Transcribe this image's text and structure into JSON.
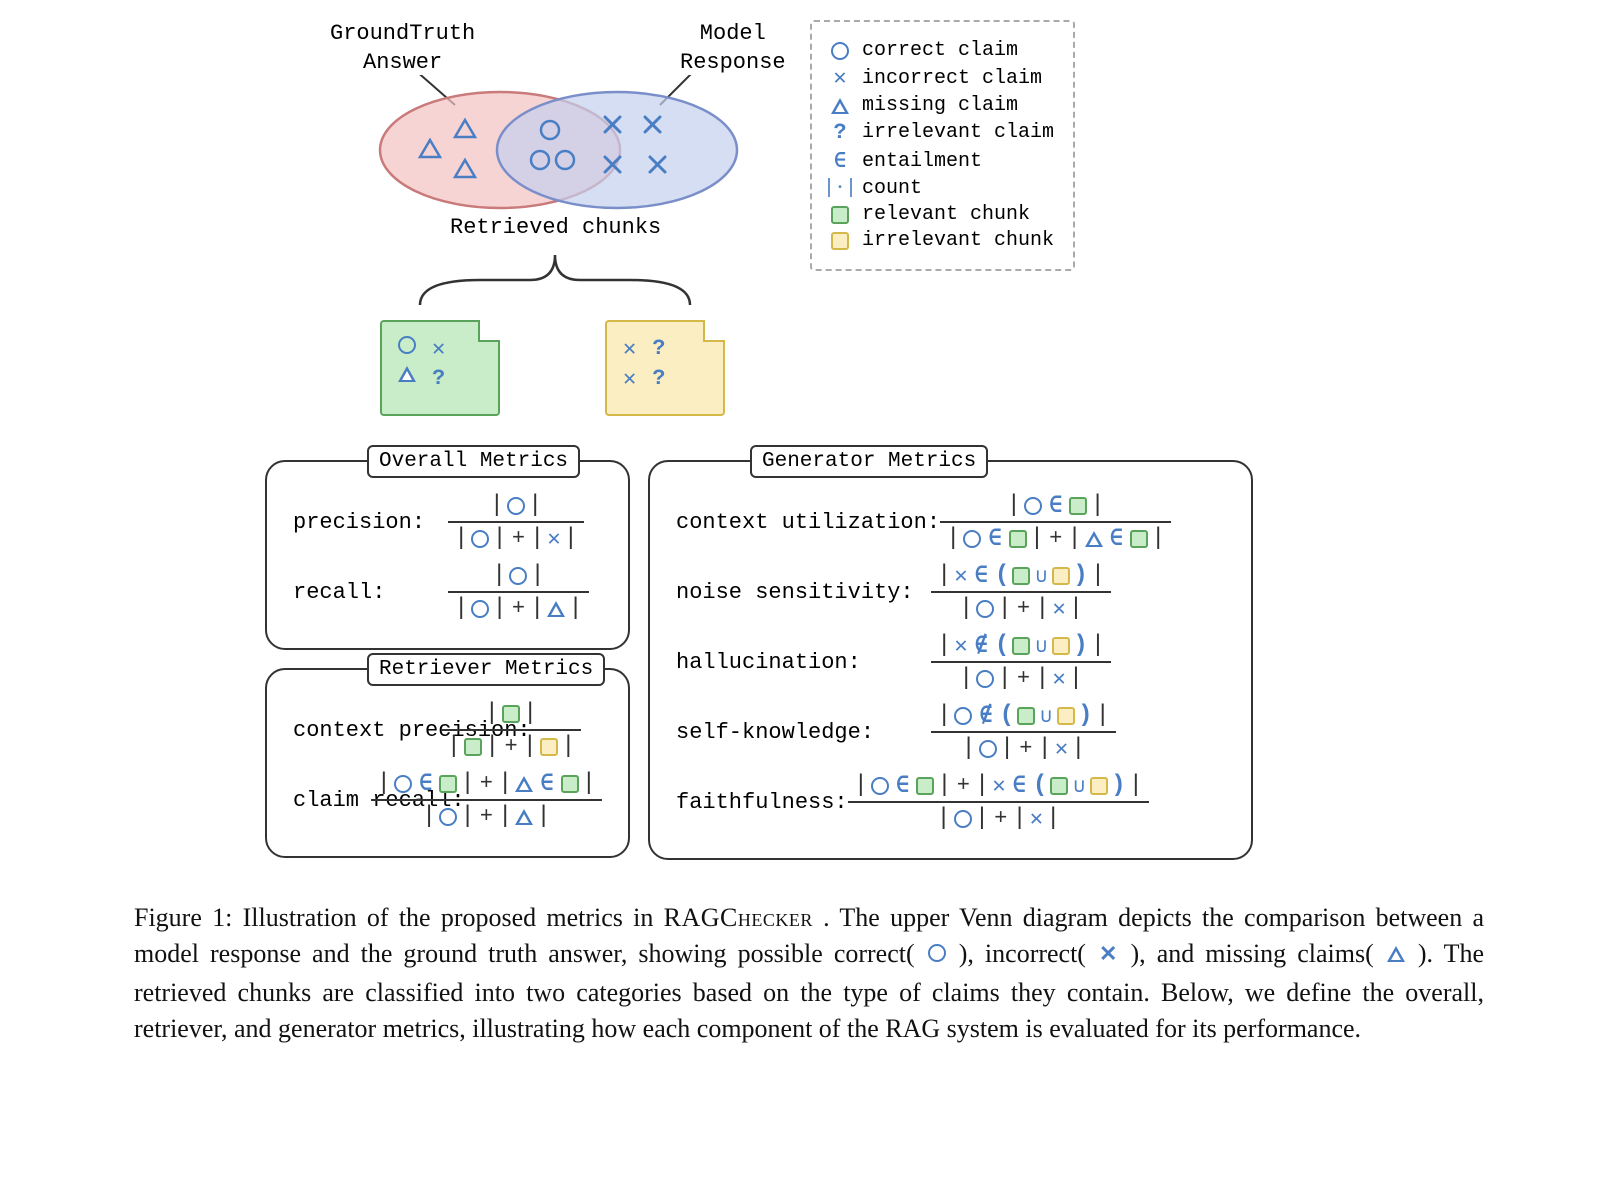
{
  "figure": {
    "labels": {
      "gt_line1": "GroundTruth",
      "gt_line2": "Answer",
      "model_line1": "Model",
      "model_line2": "Response",
      "chunks": "Retrieved chunks"
    },
    "legend": [
      {
        "icon": "circle",
        "label": "correct claim"
      },
      {
        "icon": "x",
        "label": "incorrect claim"
      },
      {
        "icon": "triangle",
        "label": "missing claim"
      },
      {
        "icon": "question",
        "label": "irrelevant claim"
      },
      {
        "icon": "entail",
        "label": "entailment"
      },
      {
        "icon": "count",
        "label": "count"
      },
      {
        "icon": "sq-green",
        "label": "relevant chunk"
      },
      {
        "icon": "sq-yellow",
        "label": "irrelevant chunk"
      }
    ],
    "metrics_groups": {
      "overall": {
        "title": "Overall Metrics",
        "rows": [
          {
            "label": "precision:"
          },
          {
            "label": "recall:"
          }
        ]
      },
      "retriever": {
        "title": "Retriever Metrics",
        "rows": [
          {
            "label": "context precision:"
          },
          {
            "label": "claim recall:"
          }
        ]
      },
      "generator": {
        "title": "Generator Metrics",
        "rows": [
          {
            "label": "context utilization:"
          },
          {
            "label": "noise sensitivity:"
          },
          {
            "label": "hallucination:"
          },
          {
            "label": "self-knowledge:"
          },
          {
            "label": "faithfulness:"
          }
        ]
      }
    }
  },
  "caption": {
    "prefix": "Figure 1: Illustration of the proposed metrics in ",
    "brand": "RAGChecker",
    "part1": " . The upper Venn diagram depicts the comparison between a model response and the ground truth answer, showing possible correct( ",
    "part2": " ), incorrect( ",
    "part3": " ), and missing claims( ",
    "part4": " ). The retrieved chunks are classified into two categories based on the type of claims they contain. Below, we define the overall, retriever, and generator metrics, illustrating how each component of the RAG system is evaluated for its performance."
  }
}
